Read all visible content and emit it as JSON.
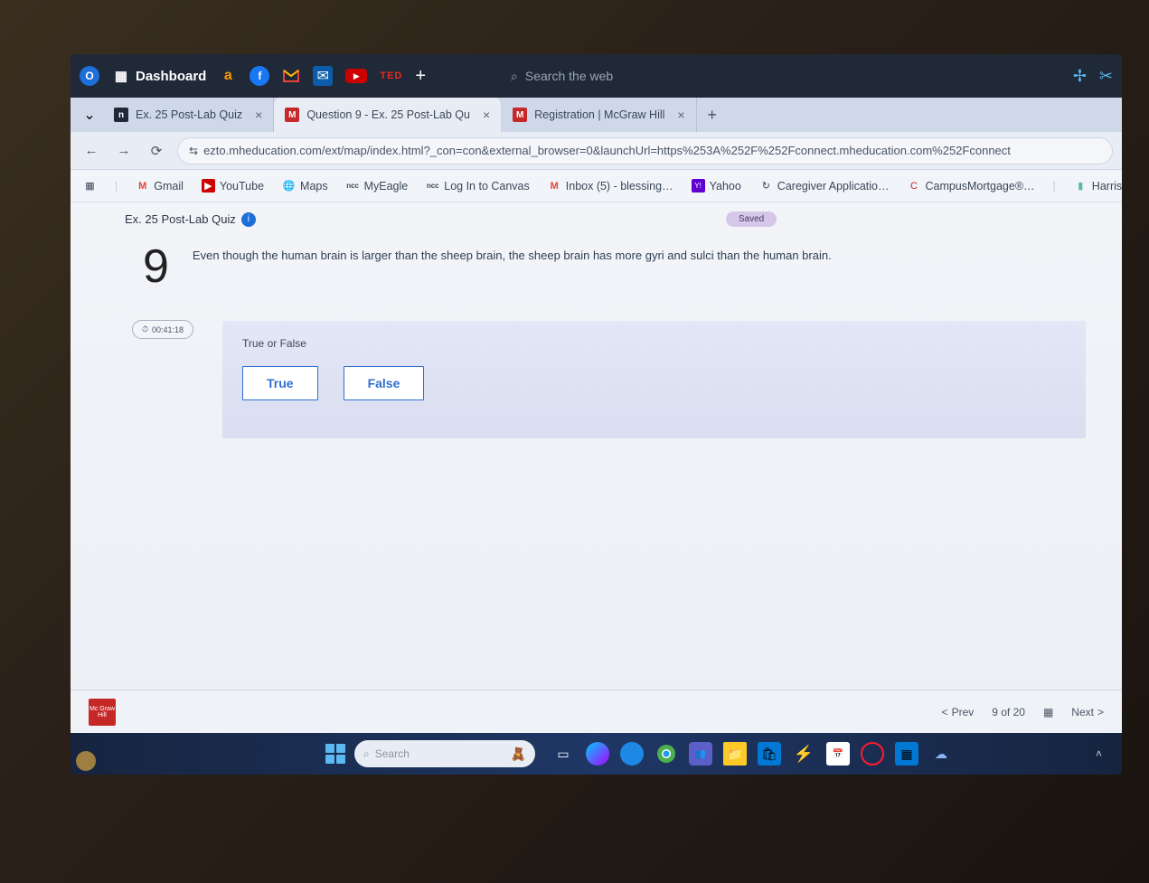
{
  "top_toolbar": {
    "dashboard_label": "Dashboard",
    "search_placeholder": "Search the web"
  },
  "tabs": [
    {
      "favicon": "ncc",
      "title": "Ex. 25 Post-Lab Quiz",
      "active": false
    },
    {
      "favicon": "M",
      "title": "Question 9 - Ex. 25 Post-Lab Qu",
      "active": true
    },
    {
      "favicon": "M",
      "title": "Registration | McGraw Hill",
      "active": false
    }
  ],
  "url": "ezto.mheducation.com/ext/map/index.html?_con=con&external_browser=0&launchUrl=https%253A%252F%252Fconnect.mheducation.com%252Fconnect",
  "bookmarks": [
    {
      "icon": "M",
      "label": "Gmail"
    },
    {
      "icon": "▶",
      "label": "YouTube"
    },
    {
      "icon": "⊕",
      "label": "Maps"
    },
    {
      "icon": "ncc",
      "label": "MyEagle"
    },
    {
      "icon": "ncc",
      "label": "Log In to Canvas"
    },
    {
      "icon": "M",
      "label": "Inbox (5) - blessing…"
    },
    {
      "icon": "Y!",
      "label": "Yahoo"
    },
    {
      "icon": "↻",
      "label": "Caregiver Applicatio…"
    },
    {
      "icon": "C",
      "label": "CampusMortgage®…"
    },
    {
      "icon": "▮",
      "label": "Harris Healt"
    }
  ],
  "quiz": {
    "title": "Ex. 25 Post-Lab Quiz",
    "saved_label": "Saved",
    "number": "9",
    "question": "Even though the human brain is larger than the sheep brain, the sheep brain has more gyri and sulci than the human brain.",
    "timer": "00:41:18",
    "tf_label": "True or False",
    "true_label": "True",
    "false_label": "False",
    "prev_label": "Prev",
    "position": "9 of 20",
    "next_label": "Next",
    "logo_text": "Mc\nGraw\nHill"
  },
  "taskbar": {
    "search_placeholder": "Search"
  }
}
